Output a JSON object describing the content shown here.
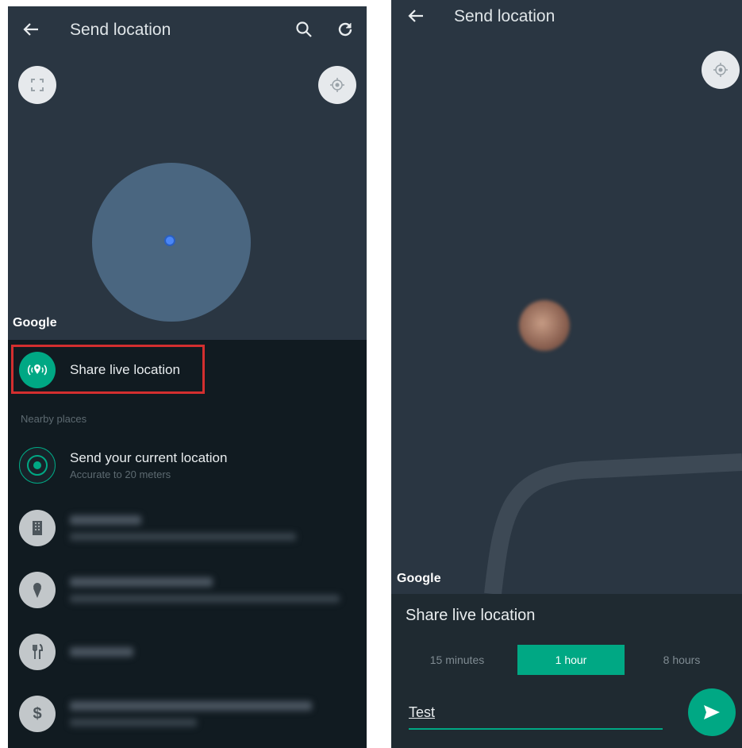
{
  "left": {
    "appbar": {
      "title": "Send location",
      "back_icon": "arrow-left-icon",
      "search_icon": "search-icon",
      "refresh_icon": "refresh-icon"
    },
    "map": {
      "attribution": "Google"
    },
    "share_live": {
      "label": "Share live location"
    },
    "nearby": {
      "heading": "Nearby places",
      "current": {
        "title": "Send your current location",
        "subtitle": "Accurate to 20 meters"
      }
    },
    "places": [
      {
        "icon": "building-icon"
      },
      {
        "icon": "ice-cream-icon"
      },
      {
        "icon": "restaurant-icon"
      },
      {
        "icon": "dollar-icon"
      }
    ]
  },
  "right": {
    "appbar": {
      "title": "Send location",
      "back_icon": "arrow-left-icon"
    },
    "map": {
      "attribution": "Google"
    },
    "sheet": {
      "title": "Share live location",
      "durations": [
        "15 minutes",
        "1 hour",
        "8 hours"
      ],
      "selected_duration": "1 hour",
      "comment_value": "Test"
    }
  },
  "colors": {
    "accent": "#00a884",
    "highlight_border": "#d32f2f",
    "sheet_bg": "#111b21"
  }
}
